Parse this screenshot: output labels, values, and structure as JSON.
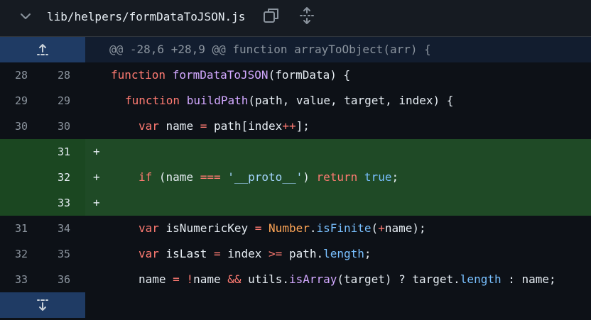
{
  "file": {
    "path": "lib/helpers/formDataToJSON.js",
    "icons": [
      "chevron-down-icon",
      "copy-icon",
      "expand-all-icon"
    ]
  },
  "hunk": {
    "header": "@@ -28,6 +28,9 @@ function arrayToObject(arr) {",
    "expand_up_icon": "expand-up-icon",
    "expand_down_icon": "expand-down-icon"
  },
  "lines": [
    {
      "old": "28",
      "new": "28",
      "marker": "",
      "type": "context"
    },
    {
      "old": "29",
      "new": "29",
      "marker": "",
      "type": "context"
    },
    {
      "old": "30",
      "new": "30",
      "marker": "",
      "type": "context"
    },
    {
      "old": "",
      "new": "31",
      "marker": "+",
      "type": "added"
    },
    {
      "old": "",
      "new": "32",
      "marker": "+",
      "type": "added"
    },
    {
      "old": "",
      "new": "33",
      "marker": "+",
      "type": "added"
    },
    {
      "old": "31",
      "new": "34",
      "marker": "",
      "type": "context"
    },
    {
      "old": "32",
      "new": "35",
      "marker": "",
      "type": "context"
    },
    {
      "old": "33",
      "new": "36",
      "marker": "",
      "type": "context"
    }
  ],
  "code": {
    "l28": {
      "kw": "function",
      "fn": "formDataToJSON",
      "rest": "(formData) {"
    },
    "l29": {
      "kw": "function",
      "fn": "buildPath",
      "rest": "(path, value, target, index) {"
    },
    "l30": {
      "kw": "var",
      "a": " name ",
      "op": "=",
      "b": " path[index",
      "inc": "++",
      "c": "];"
    },
    "l32": {
      "kw": "if",
      "a": " (name ",
      "op": "===",
      "b": " ",
      "str": "'__proto__'",
      "c": ") ",
      "ret": "return",
      "d": " ",
      "bool": "true",
      "e": ";"
    },
    "l34": {
      "kw": "var",
      "a": " isNumericKey ",
      "op": "=",
      "b": " ",
      "cls": "Number",
      "dot": ".",
      "fn": "isFinite",
      "c": "(",
      "plus": "+",
      "d": "name);"
    },
    "l35": {
      "kw": "var",
      "a": " isLast ",
      "op": "=",
      "b": " index ",
      "op2": ">=",
      "c": " path.",
      "prop": "length",
      "d": ";"
    },
    "l36": {
      "a": "name ",
      "op": "=",
      "b": " ",
      "not": "!",
      "c": "name ",
      "and": "&&",
      "d": " utils.",
      "fn": "isArray",
      "e": "(target) ? target.",
      "prop": "length",
      "f": " : name;"
    }
  },
  "colors": {
    "keyword": "#ff7b72",
    "function": "#d2a8ff",
    "constant": "#79c0ff",
    "string": "#a5d6ff",
    "class": "#ffa657",
    "added_bg": "#1f4a26",
    "hunk_gutter": "#1f3b64"
  }
}
